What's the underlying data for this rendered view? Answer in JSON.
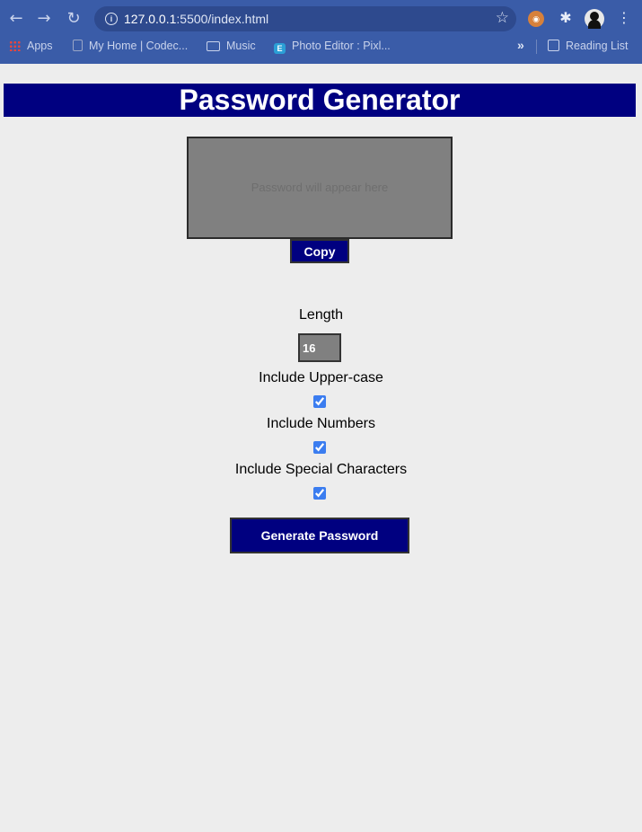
{
  "browser": {
    "url_host": "127.0.0.1",
    "url_path": ":5500/index.html",
    "bookmarks": [
      {
        "label": "Apps",
        "icon": "apps-icon"
      },
      {
        "label": "My Home | Codec...",
        "icon": "document-icon"
      },
      {
        "label": "Music",
        "icon": "folder-icon"
      },
      {
        "label": "Photo Editor : Pixl...",
        "icon": "photo-editor-icon"
      }
    ],
    "more_label": "»",
    "reading_list": "Reading List"
  },
  "page": {
    "title": "Password Generator",
    "output_placeholder": "Password will appear here",
    "copy_label": "Copy",
    "length_label": "Length",
    "length_value": "16",
    "options": [
      {
        "label": "Include Upper-case",
        "checked": true
      },
      {
        "label": "Include Numbers",
        "checked": true
      },
      {
        "label": "Include Special Characters",
        "checked": true
      }
    ],
    "generate_label": "Generate Password"
  },
  "colors": {
    "accent": "#000080",
    "browser_chrome": "#3a5ca8",
    "field_bg": "#808080",
    "page_bg": "#ededed"
  }
}
